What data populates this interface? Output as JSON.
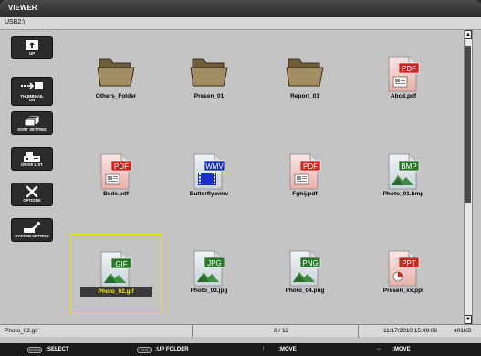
{
  "window": {
    "title": "VIEWER",
    "path": "USB2:\\"
  },
  "sidebar": [
    {
      "key": "up",
      "label": "UP",
      "icon": "up-folder-icon"
    },
    {
      "key": "thumbnail",
      "label": "THUMBNAIL\nON",
      "icon": "thumbnail-toggle-icon"
    },
    {
      "key": "sort",
      "label": "SORT SETTING",
      "icon": "sort-stack-icon"
    },
    {
      "key": "drive",
      "label": "DRIVE LIST",
      "icon": "drive-list-icon"
    },
    {
      "key": "options",
      "label": "OPTIONS",
      "icon": "tools-icon"
    },
    {
      "key": "system",
      "label": "SYSTEM SETTING",
      "icon": "system-wrench-icon"
    }
  ],
  "files": [
    {
      "name": "Others_Folder",
      "type": "folder"
    },
    {
      "name": "Presen_01",
      "type": "folder"
    },
    {
      "name": "Report_01",
      "type": "folder"
    },
    {
      "name": "Abcd.pdf",
      "type": "PDF"
    },
    {
      "name": "Bcde.pdf",
      "type": "PDF"
    },
    {
      "name": "Butterfly.wmv",
      "type": "WMV"
    },
    {
      "name": "Fghij.pdf",
      "type": "PDF"
    },
    {
      "name": "Photo_01.bmp",
      "type": "BMP"
    },
    {
      "name": "Photo_02.gif",
      "type": "GIF",
      "selected": true
    },
    {
      "name": "Photo_03.jpg",
      "type": "JPG"
    },
    {
      "name": "Photo_04.png",
      "type": "PNG"
    },
    {
      "name": "Presen_xx.ppt",
      "type": "PPT"
    }
  ],
  "colors": {
    "PDF": "#d8221e",
    "WMV": "#1a2ec8",
    "BMP": "#2a7a2a",
    "GIF": "#2a7a2a",
    "JPG": "#2a7a2a",
    "PNG": "#2a7a2a",
    "PPT": "#d8221e",
    "selection": "#e8e400"
  },
  "status": {
    "filename": "Photo_02.gif",
    "position": "6 / 12",
    "timestamp": "11/17/2010 15:49:06",
    "size": "401KB"
  },
  "help": {
    "enter_key": "ENTER",
    "enter_text": ":SELECT",
    "exit_key": "EXIT",
    "exit_text": ":UP FOLDER",
    "updown_arrow": "↕",
    "updown_text": ":MOVE",
    "leftright_arrow": "↔",
    "leftright_text": ":MOVE"
  },
  "scroll": {
    "up_arrow": "▲",
    "down_arrow": "▼"
  }
}
